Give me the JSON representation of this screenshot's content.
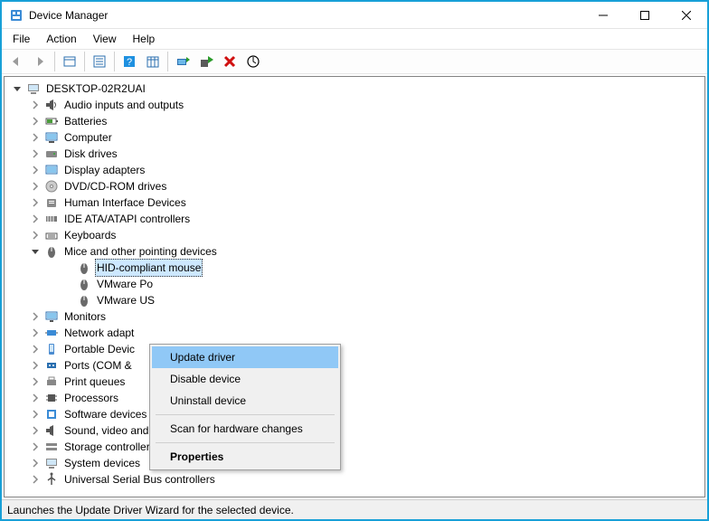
{
  "title": "Device Manager",
  "menu": {
    "file": "File",
    "action": "Action",
    "view": "View",
    "help": "Help"
  },
  "root": "DESKTOP-02R2UAI",
  "categories": [
    {
      "label": "Audio inputs and outputs"
    },
    {
      "label": "Batteries"
    },
    {
      "label": "Computer"
    },
    {
      "label": "Disk drives"
    },
    {
      "label": "Display adapters"
    },
    {
      "label": "DVD/CD-ROM drives"
    },
    {
      "label": "Human Interface Devices"
    },
    {
      "label": "IDE ATA/ATAPI controllers"
    },
    {
      "label": "Keyboards"
    },
    {
      "label": "Mice and other pointing devices",
      "expanded": true,
      "children": [
        {
          "label": "HID-compliant mouse",
          "selected": true
        },
        {
          "label": "VMware Po"
        },
        {
          "label": "VMware US"
        }
      ]
    },
    {
      "label": "Monitors"
    },
    {
      "label": "Network adapt"
    },
    {
      "label": "Portable Devic"
    },
    {
      "label": "Ports (COM &"
    },
    {
      "label": "Print queues"
    },
    {
      "label": "Processors"
    },
    {
      "label": "Software devices"
    },
    {
      "label": "Sound, video and game controllers"
    },
    {
      "label": "Storage controllers"
    },
    {
      "label": "System devices"
    },
    {
      "label": "Universal Serial Bus controllers"
    }
  ],
  "context": {
    "update": "Update driver",
    "disable": "Disable device",
    "uninstall": "Uninstall device",
    "scan": "Scan for hardware changes",
    "properties": "Properties"
  },
  "status": "Launches the Update Driver Wizard for the selected device."
}
